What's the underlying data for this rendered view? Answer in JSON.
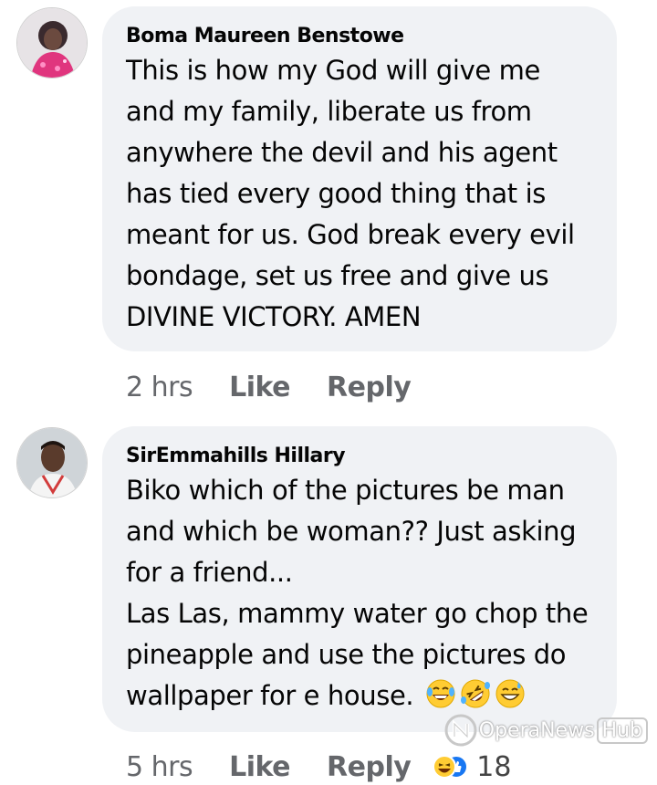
{
  "comments": [
    {
      "author": "Boma Maureen Benstowe",
      "text": "This is how my God will give me\nand my family, liberate us from\nanywhere the devil and his agent\nhas tied every good thing that is\nmeant for us. God break every evil\nbondage, set us free and give us\nDIVINE VICTORY. AMEN",
      "time": "2 hrs",
      "like_label": "Like",
      "reply_label": "Reply"
    },
    {
      "author": "SirEmmahills Hillary",
      "text": "Biko which of the pictures be man\nand which be woman?? Just asking\nfor a friend...\nLas Las, mammy water go chop the\npineapple and use the pictures do\nwallpaper for e house.",
      "emojis": [
        "face-with-tears-of-joy",
        "rolling-on-floor-laughing",
        "grinning-face-with-sweat"
      ],
      "time": "5 hrs",
      "like_label": "Like",
      "reply_label": "Reply",
      "reaction_count": "18",
      "reaction_icons": [
        "haha-reaction",
        "like-reaction"
      ]
    }
  ],
  "watermark": {
    "brand": "OperaNews",
    "suffix": "Hub"
  },
  "colors": {
    "bubble": "#f0f2f5",
    "meta": "#65676b",
    "text": "#050505"
  }
}
